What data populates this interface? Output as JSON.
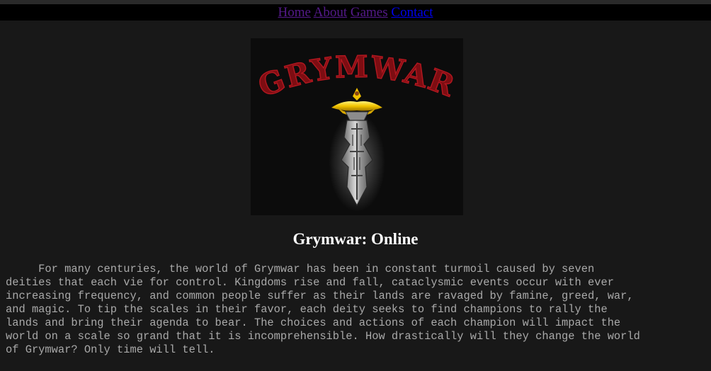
{
  "nav": {
    "home": "Home",
    "about": "About",
    "games": "Games",
    "contact": "Contact"
  },
  "logo": {
    "wordmark": "GRYMWAR",
    "icon": "sword-icon"
  },
  "heading": "Grymwar: Online",
  "story": {
    "lines": [
      "     For many centuries, the world of Grymwar has been in constant turmoil caused by seven",
      "deities that each vie for control. Kingdoms rise and fall, cataclysmic events occur with ever",
      "increasing frequency, and common people suffer as their lands are ravaged by famine, greed, war,",
      "and magic. To tip the scales in their favor, each deity seeks to find champions to rally the",
      "lands and bring their agenda to bear. The choices and actions of each champion will impact the",
      "world on a scale so grand that it is incomprehensible. How drastically will they change the world",
      "of Grymwar? Only time will tell."
    ]
  },
  "colors": {
    "background": "#181818",
    "navbar": "#000000",
    "visited_link": "#551a8b",
    "unvisited_link": "#0000ee",
    "logo_red": "#8b0f14",
    "text": "#a9a9a9",
    "heading": "#ffffff"
  }
}
